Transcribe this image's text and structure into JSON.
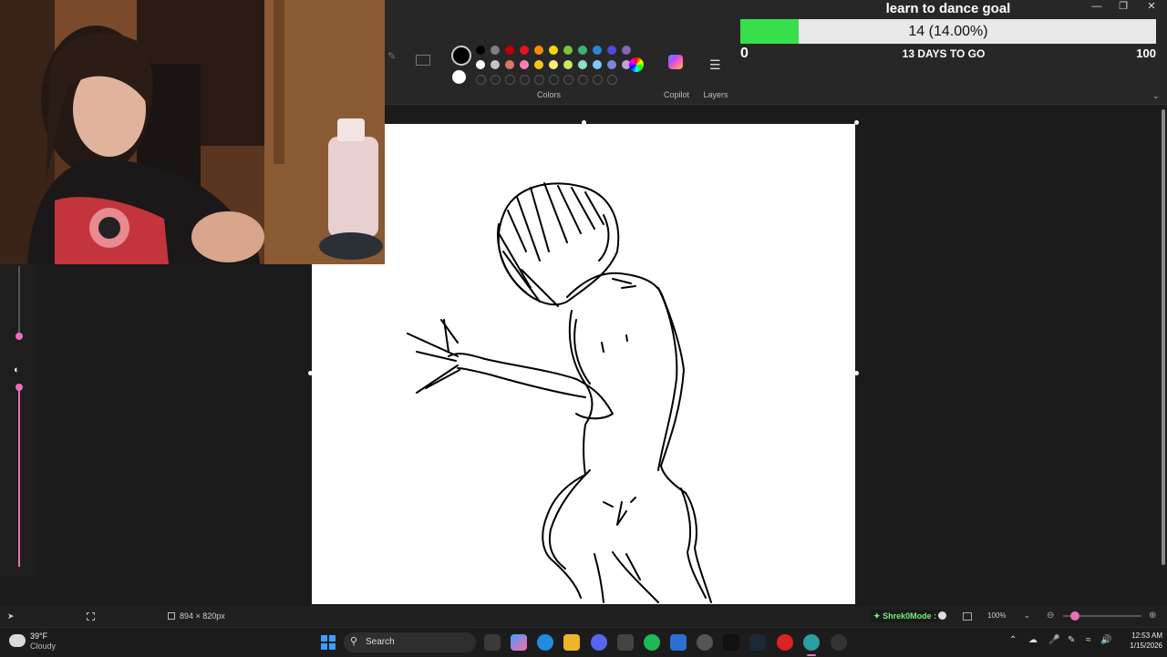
{
  "goal": {
    "title": "learn to dance goal",
    "progress_text": "14 (14.00%)",
    "progress_fraction": 0.14,
    "min": "0",
    "max": "100",
    "days_left": "13 DAYS TO GO",
    "fill_color": "#37e04a"
  },
  "ribbon": {
    "colors_label": "Colors",
    "copilot_label": "Copilot",
    "layers_label": "Layers",
    "selected_primary": "#000000",
    "selected_secondary": "#ffffff",
    "palette_row1": [
      "#000000",
      "#7f7f7f",
      "#c00000",
      "#e81123",
      "#ff8c00",
      "#ffd700",
      "#7cc142",
      "#3cb371",
      "#2b88d8",
      "#4b4bd8",
      "#8764b8"
    ],
    "palette_row2": [
      "#ffffff",
      "#c3c3c3",
      "#d47b62",
      "#ff7fae",
      "#f5c518",
      "#fff176",
      "#c6e85b",
      "#8ae0c8",
      "#7ec8ff",
      "#7a86d8",
      "#c59ee0"
    ]
  },
  "status": {
    "canvas_size": "894 × 820px",
    "stream_tag": "Shrek0Mode :",
    "zoom": "100%"
  },
  "taskbar": {
    "temperature": "39°F",
    "weather": "Cloudy",
    "search_placeholder": "Search",
    "time": "12:53 AM",
    "date": "1/15/2026"
  },
  "accent": "#e86fb8"
}
